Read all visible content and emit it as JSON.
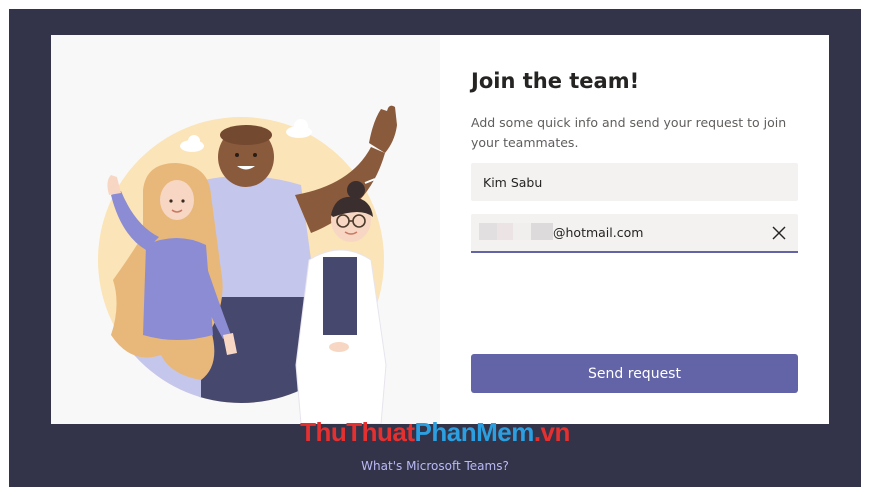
{
  "form": {
    "title": "Join the team!",
    "subtitle": "Add some quick info and send your request to join your teammates.",
    "name_value": "Kim Sabu",
    "email_value": "@hotmail.com",
    "send_label": "Send request"
  },
  "footer": {
    "link_label": "What's Microsoft Teams?"
  },
  "watermark": {
    "part1": "Thu",
    "part2": "Thuat",
    "part3": "PhanMem",
    "part4": ".vn"
  },
  "colors": {
    "backdrop": "#33344a",
    "accent": "#6264a7",
    "field_bg": "#f3f2f1",
    "hero_circle": "#fbe4b7",
    "footer_link": "#b9baf5"
  },
  "icons": {
    "clear": "close-icon"
  }
}
